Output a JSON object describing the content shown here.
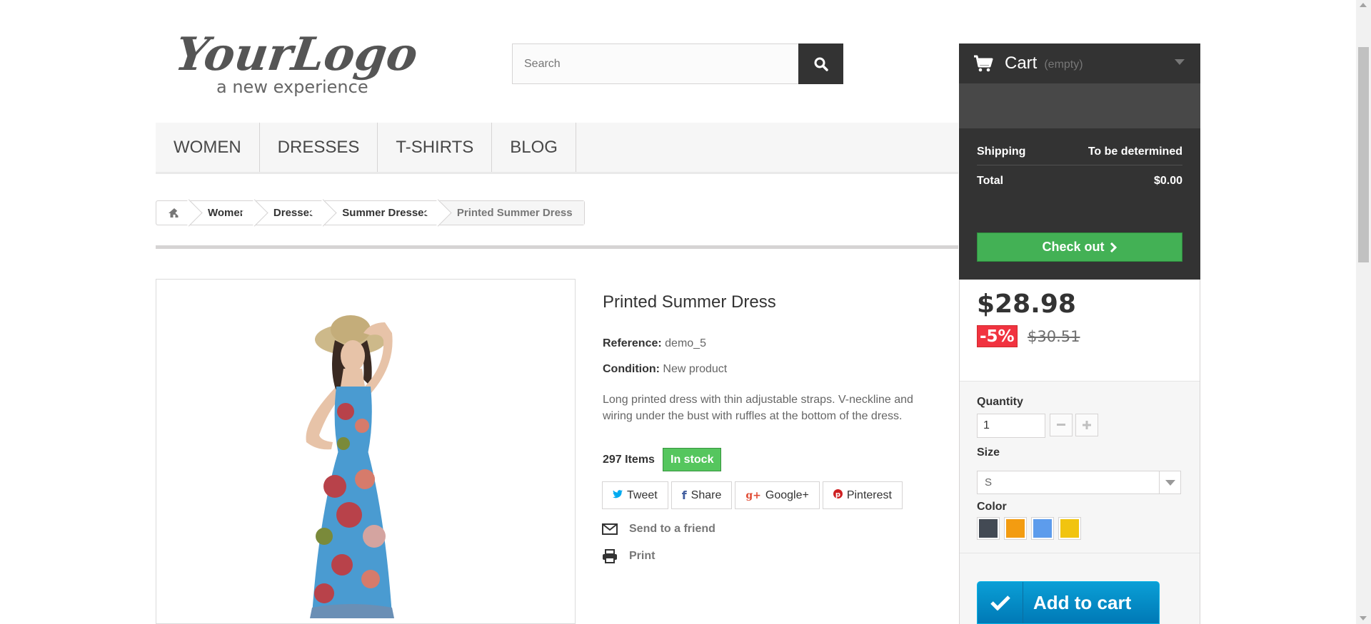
{
  "logo": {
    "main_text": "YourLogo",
    "tagline": "a new experience"
  },
  "search": {
    "placeholder": "Search",
    "button_icon": "search-icon"
  },
  "nav": {
    "items": [
      {
        "label": "WOMEN"
      },
      {
        "label": "DRESSES"
      },
      {
        "label": "T-SHIRTS"
      },
      {
        "label": "BLOG"
      }
    ]
  },
  "breadcrumb": {
    "home_icon": "home-icon",
    "items": [
      "Women",
      "Dresses",
      "Summer Dresses"
    ],
    "current": "Printed Summer Dress"
  },
  "product": {
    "title": "Printed Summer Dress",
    "reference_label": "Reference:",
    "reference_value": "demo_5",
    "condition_label": "Condition:",
    "condition_value": "New product",
    "description": "Long printed dress with thin adjustable straps. V-neckline and wiring under the bust with ruffles at the bottom of the dress.",
    "quantity_items": "297 Items",
    "stock_status": "In stock",
    "social": [
      {
        "label": "Tweet",
        "icon": "twitter-icon",
        "color": "#00aaf0"
      },
      {
        "label": "Share",
        "icon": "facebook-icon",
        "color": "#435f9f"
      },
      {
        "label": "Google+",
        "icon": "google-plus-icon",
        "color": "#e04b34"
      },
      {
        "label": "Pinterest",
        "icon": "pinterest-icon",
        "color": "#ce1f21"
      }
    ],
    "send_to_friend": "Send to a friend",
    "print": "Print"
  },
  "cart": {
    "label": "Cart",
    "status": "(empty)",
    "shipping_label": "Shipping",
    "shipping_value": "To be determined",
    "total_label": "Total",
    "total_value": "$0.00",
    "checkout_label": "Check out",
    "checkout_icon": "chevron-right-icon"
  },
  "buy_box": {
    "price": "$28.98",
    "discount": "-5%",
    "old_price": "$30.51",
    "quantity_label": "Quantity",
    "quantity_value": "1",
    "size_label": "Size",
    "size_value": "S",
    "color_label": "Color",
    "colors": [
      "#434a54",
      "#f39c11",
      "#5d9cec",
      "#f1c40f"
    ],
    "add_to_cart_label": "Add to cart"
  },
  "colors": {
    "accent_green": "#55c65e",
    "checkout_green": "#43b155",
    "dark": "#333333",
    "discount_red": "#f13340",
    "add_to_cart_blue": "#0a9fd6"
  }
}
